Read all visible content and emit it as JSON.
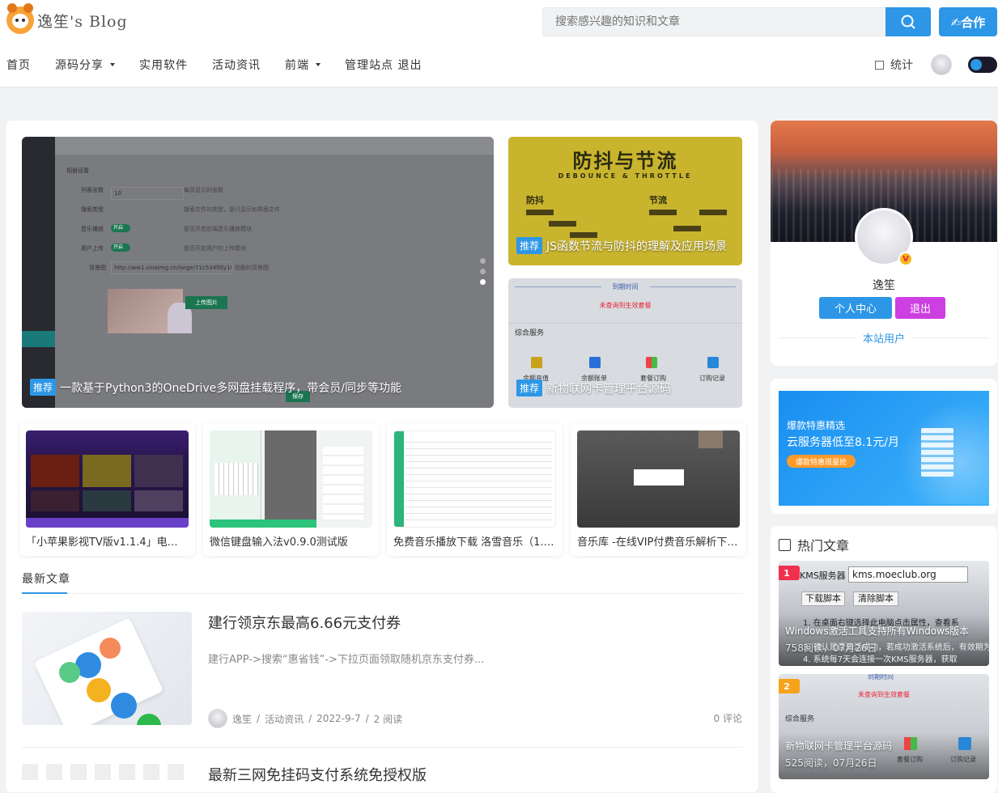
{
  "header": {
    "site_name": "逸笙's Blog",
    "search_placeholder": "搜索感兴趣的知识和文章",
    "coop_label": "✍合作",
    "stats_label": "统计"
  },
  "nav": [
    {
      "label": "首页",
      "dropdown": false
    },
    {
      "label": "源码分享",
      "dropdown": true
    },
    {
      "label": "实用软件",
      "dropdown": false
    },
    {
      "label": "活动资讯",
      "dropdown": false
    },
    {
      "label": "前端",
      "dropdown": true
    },
    {
      "label": "管理站点 退出",
      "dropdown": false
    }
  ],
  "featured": {
    "main": {
      "badge": "推荐",
      "title": "一款基于Python3的OneDrive多网盘挂载程序，带会员/同步等功能",
      "upload": "上传图片",
      "save": "保存",
      "form": [
        "相册设置",
        "列表张数",
        "搜索类型",
        "音乐播放",
        "用户上传",
        "背景图"
      ],
      "values": [
        "10",
        "每页显示的张数",
        "搜索文件的类型，是只显示如界面文件",
        "开启",
        "是否开启前端音乐播放模块",
        "开启",
        "是否开启用户的上传模块"
      ],
      "url": "http://ww1.sinaimg.cn/large/71c534f0ly1fw9tw",
      "url_tip": "相册的背景图"
    },
    "top_right": {
      "badge": "推荐",
      "title": "JS函数节流与防抖的理解及应用场景",
      "img_title": "防抖与节流",
      "img_sub": "DEBOUNCE & THROTTLE",
      "left": "防抖",
      "right": "节流"
    },
    "bottom_right": {
      "badge": "推荐",
      "title": "新物联网卡管理平台源码",
      "head": "到期时间",
      "red": "未查询到生效套餐",
      "section": "综合服务",
      "icons": [
        "余额充值",
        "余额账单",
        "套餐订购",
        "订购记录"
      ]
    }
  },
  "thumbs": [
    {
      "title": "「小苹果影视TV版v1.1.4」电视盒子..."
    },
    {
      "title": "微信键盘输入法v0.9.0测试版"
    },
    {
      "title": "免费音乐播放下载 洛雪音乐（1.1..."
    },
    {
      "title": "音乐库 -在线VIP付费音乐解析下载..."
    }
  ],
  "latest": {
    "heading": "最新文章",
    "articles": [
      {
        "title": "建行领京东最高6.66元支付券",
        "desc": "建行APP->搜索“惠省钱”->下拉页面领取随机京东支付券...",
        "author": "逸笙",
        "category": "活动资讯",
        "date": "2022-9-7",
        "reads": "2 阅读",
        "comments": "0 评论"
      },
      {
        "title": "最新三网免挂码支付系统免授权版"
      }
    ]
  },
  "profile": {
    "name": "逸笙",
    "btn_center": "个人中心",
    "btn_logout": "退出",
    "role": "本站用户",
    "badge": "V"
  },
  "ad": {
    "line1": "爆款特惠精选",
    "line2": "云服务器低至8.1元/月",
    "button": "爆款特惠限量抢"
  },
  "hot": {
    "heading": "热门文章",
    "items": [
      {
        "rank": "1",
        "title": "Windows激活工具支持所有Windows版本",
        "meta": "758阅读，07月26日",
        "label": "KMS服务器",
        "value": "kms.moeclub.org",
        "btn1": "下载脚本",
        "btn2": "清除脚本",
        "l1": "1. 在桌面右键选择此电脑点击属性，查看系",
        "l2": "3. 确认是否激活成功，若成功激活系统后，有效期为",
        "l3": "4. 系统每7天会连接一次KMS服务器，获取"
      },
      {
        "rank": "2",
        "title": "新物联网卡管理平台源码",
        "meta": "525阅读，07月26日",
        "head": "到期时间",
        "red": "未查询到生效套餐",
        "section": "综合服务",
        "i1": "套餐订购",
        "i2": "订购记录"
      }
    ]
  },
  "colors": {
    "accent": "#2d96e6",
    "logout": "#cc3fe0",
    "rank1": "#f0304c",
    "rank2": "#f6a21a"
  }
}
